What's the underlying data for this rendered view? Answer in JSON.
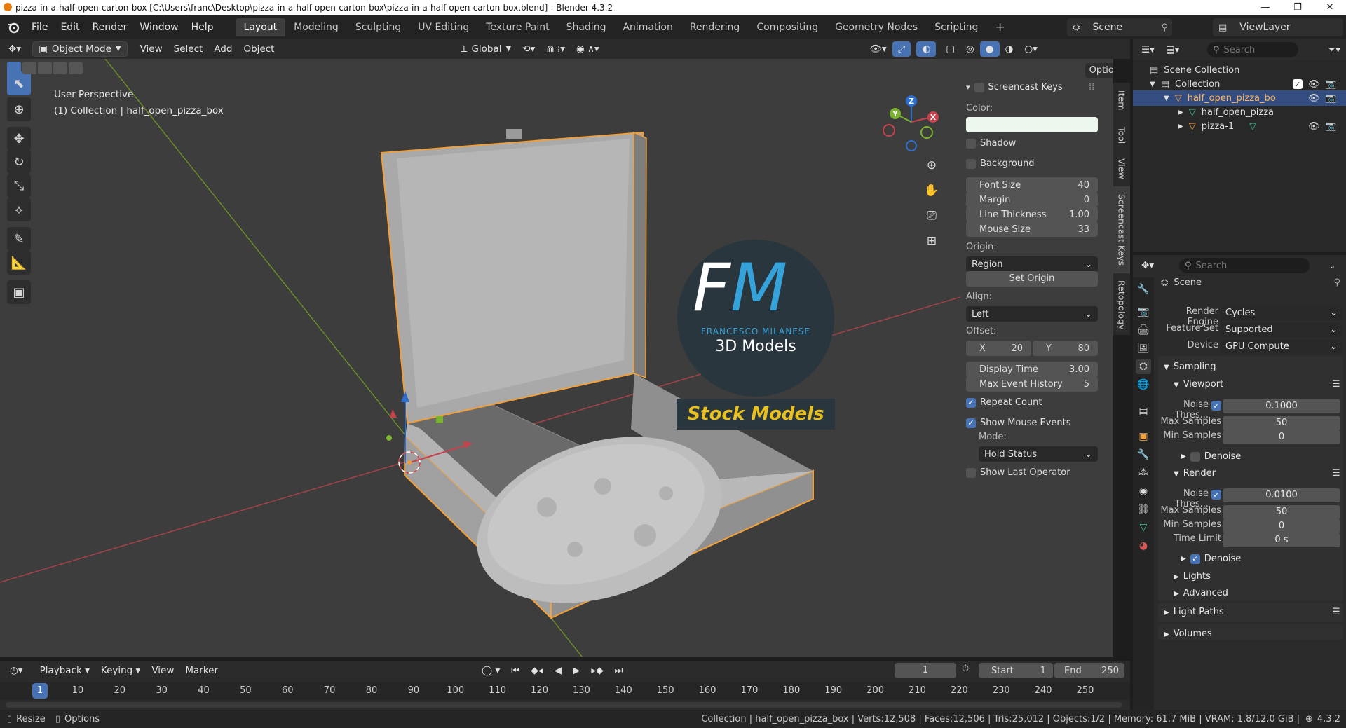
{
  "window": {
    "title": "pizza-in-a-half-open-carton-box [C:\\Users\\franc\\Desktop\\pizza-in-a-half-open-carton-box\\pizza-in-a-half-open-carton-box.blend] - Blender 4.3.2",
    "minimize": "—",
    "maximize": "❐",
    "close": "✕"
  },
  "menu": {
    "items": [
      "File",
      "Edit",
      "Render",
      "Window",
      "Help"
    ]
  },
  "workspaces": [
    "Layout",
    "Modeling",
    "Sculpting",
    "UV Editing",
    "Texture Paint",
    "Shading",
    "Animation",
    "Rendering",
    "Compositing",
    "Geometry Nodes",
    "Scripting"
  ],
  "workspace_add": "+",
  "scene_name": "Scene",
  "view_layer": "ViewLayer",
  "viewport_header": {
    "mode": "Object Mode",
    "menus": [
      "View",
      "Select",
      "Add",
      "Object"
    ],
    "transform_orientation": "Global",
    "options": "Options"
  },
  "viewport": {
    "perspective": "User Perspective",
    "collection_info": "(1) Collection | half_open_pizza_box",
    "gizmo": {
      "x": "X",
      "y": "Y",
      "z": "Z"
    }
  },
  "watermark": {
    "letters_f": "F",
    "letters_m": "M",
    "name": "FRANCESCO MILANESE",
    "sub": "3D Models",
    "stock": "Stock Models"
  },
  "screencast_panel": {
    "title": "Screencast Keys",
    "color_label": "Color:",
    "color_value": "#eef7ee",
    "shadow": "Shadow",
    "background": "Background",
    "fields": [
      {
        "label": "Font Size",
        "value": "40"
      },
      {
        "label": "Margin",
        "value": "0"
      },
      {
        "label": "Line Thickness",
        "value": "1.00"
      },
      {
        "label": "Mouse Size",
        "value": "33"
      }
    ],
    "origin_label": "Origin:",
    "origin_value": "Region",
    "set_origin": "Set Origin",
    "align_label": "Align:",
    "align_value": "Left",
    "offset_label": "Offset:",
    "offset_x_label": "X",
    "offset_x": "20",
    "offset_y_label": "Y",
    "offset_y": "80",
    "display_time_label": "Display Time",
    "display_time": "3.00",
    "max_event_label": "Max Event History",
    "max_event": "5",
    "repeat_count": "Repeat Count",
    "show_mouse_events": "Show Mouse Events",
    "mode_label": "Mode:",
    "mode_value": "Hold Status",
    "show_last_operator": "Show Last Operator"
  },
  "sidebar_tabs": [
    "Item",
    "Tool",
    "View",
    "Screencast Keys",
    "Retopology"
  ],
  "timeline": {
    "menus": [
      "Playback",
      "Keying",
      "View",
      "Marker"
    ],
    "current_frame": "1",
    "start_label": "Start",
    "start": "1",
    "end_label": "End",
    "end": "250",
    "ticks": [
      "1",
      "10",
      "20",
      "30",
      "40",
      "50",
      "60",
      "70",
      "80",
      "90",
      "100",
      "110",
      "120",
      "130",
      "140",
      "150",
      "160",
      "170",
      "180",
      "190",
      "200",
      "210",
      "220",
      "230",
      "240",
      "250"
    ]
  },
  "statusbar": {
    "left": [
      "Resize",
      "Options"
    ],
    "stats": "Collection | half_open_pizza_box | Verts:12,508 | Faces:12,506 | Tris:25,012 | Objects:1/2 | Memory: 61.7 MiB | VRAM: 1.8/12.0 GiB |",
    "version": "4.3.2"
  },
  "outliner": {
    "search_placeholder": "Search",
    "rows": [
      {
        "label": "Scene Collection"
      },
      {
        "label": "Collection"
      },
      {
        "label": "half_open_pizza_bo"
      },
      {
        "label": "half_open_pizza"
      },
      {
        "label": "pizza-1"
      }
    ]
  },
  "properties": {
    "search_placeholder": "Search",
    "context": "Scene",
    "render_engine_label": "Render Engine",
    "render_engine": "Cycles",
    "feature_set_label": "Feature Set",
    "feature_set": "Supported",
    "device_label": "Device",
    "device": "GPU Compute",
    "sampling": "Sampling",
    "viewport": "Viewport",
    "vp_noise_label": "Noise Thres...",
    "vp_noise": "0.1000",
    "vp_max_label": "Max Samples",
    "vp_max": "50",
    "vp_min_label": "Min Samples",
    "vp_min": "0",
    "denoise": "Denoise",
    "render": "Render",
    "r_noise_label": "Noise Thres...",
    "r_noise": "0.0100",
    "r_max_label": "Max Samples",
    "r_max": "50",
    "r_min_label": "Min Samples",
    "r_min": "0",
    "time_limit_label": "Time Limit",
    "time_limit": "0 s",
    "denoise2": "Denoise",
    "lights": "Lights",
    "advanced": "Advanced",
    "light_paths": "Light Paths",
    "volumes": "Volumes"
  },
  "colors": {
    "accent": "#4772b3",
    "selection": "#f5a037",
    "x_axis": "#c8424c",
    "y_axis": "#7ab32e",
    "z_axis": "#2d6fcf"
  }
}
